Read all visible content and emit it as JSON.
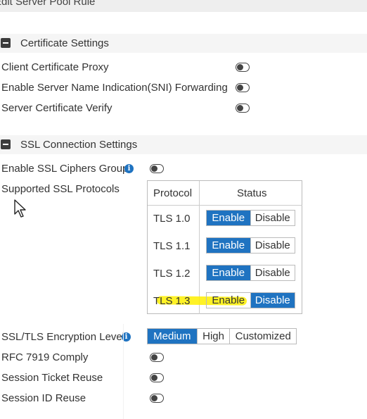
{
  "header": {
    "title": "Edit Server Pool Rule"
  },
  "certificate_section": {
    "title": "Certificate Settings",
    "rows": [
      {
        "label": "Client Certificate Proxy",
        "enabled": false
      },
      {
        "label": "Enable Server Name Indication(SNI) Forwarding",
        "enabled": false
      },
      {
        "label": "Server Certificate Verify",
        "enabled": false
      }
    ]
  },
  "ssl_section": {
    "title": "SSL Connection Settings",
    "ciphers_group": {
      "label": "Enable SSL Ciphers Group",
      "enabled": false,
      "icon": "info-icon"
    },
    "protocols": {
      "label": "Supported SSL Protocols",
      "headers": {
        "protocol": "Protocol",
        "status": "Status"
      },
      "enable_label": "Enable",
      "disable_label": "Disable",
      "rows": [
        {
          "protocol": "TLS 1.0",
          "status": "Enable"
        },
        {
          "protocol": "TLS 1.1",
          "status": "Enable"
        },
        {
          "protocol": "TLS 1.2",
          "status": "Enable"
        },
        {
          "protocol": "TLS 1.3",
          "status": "Disable"
        }
      ]
    },
    "encryption_level": {
      "label": "SSL/TLS Encryption Level",
      "icon": "info-icon",
      "options": [
        "Medium",
        "High",
        "Customized"
      ],
      "selected": "Medium"
    },
    "rfc7919": {
      "label": "RFC 7919 Comply",
      "enabled": false
    },
    "session_ticket": {
      "label": "Session Ticket Reuse",
      "enabled": false
    },
    "session_id": {
      "label": "Session ID Reuse",
      "enabled": false
    }
  },
  "colors": {
    "accent": "#1f73c1",
    "highlight": "#fff000"
  }
}
